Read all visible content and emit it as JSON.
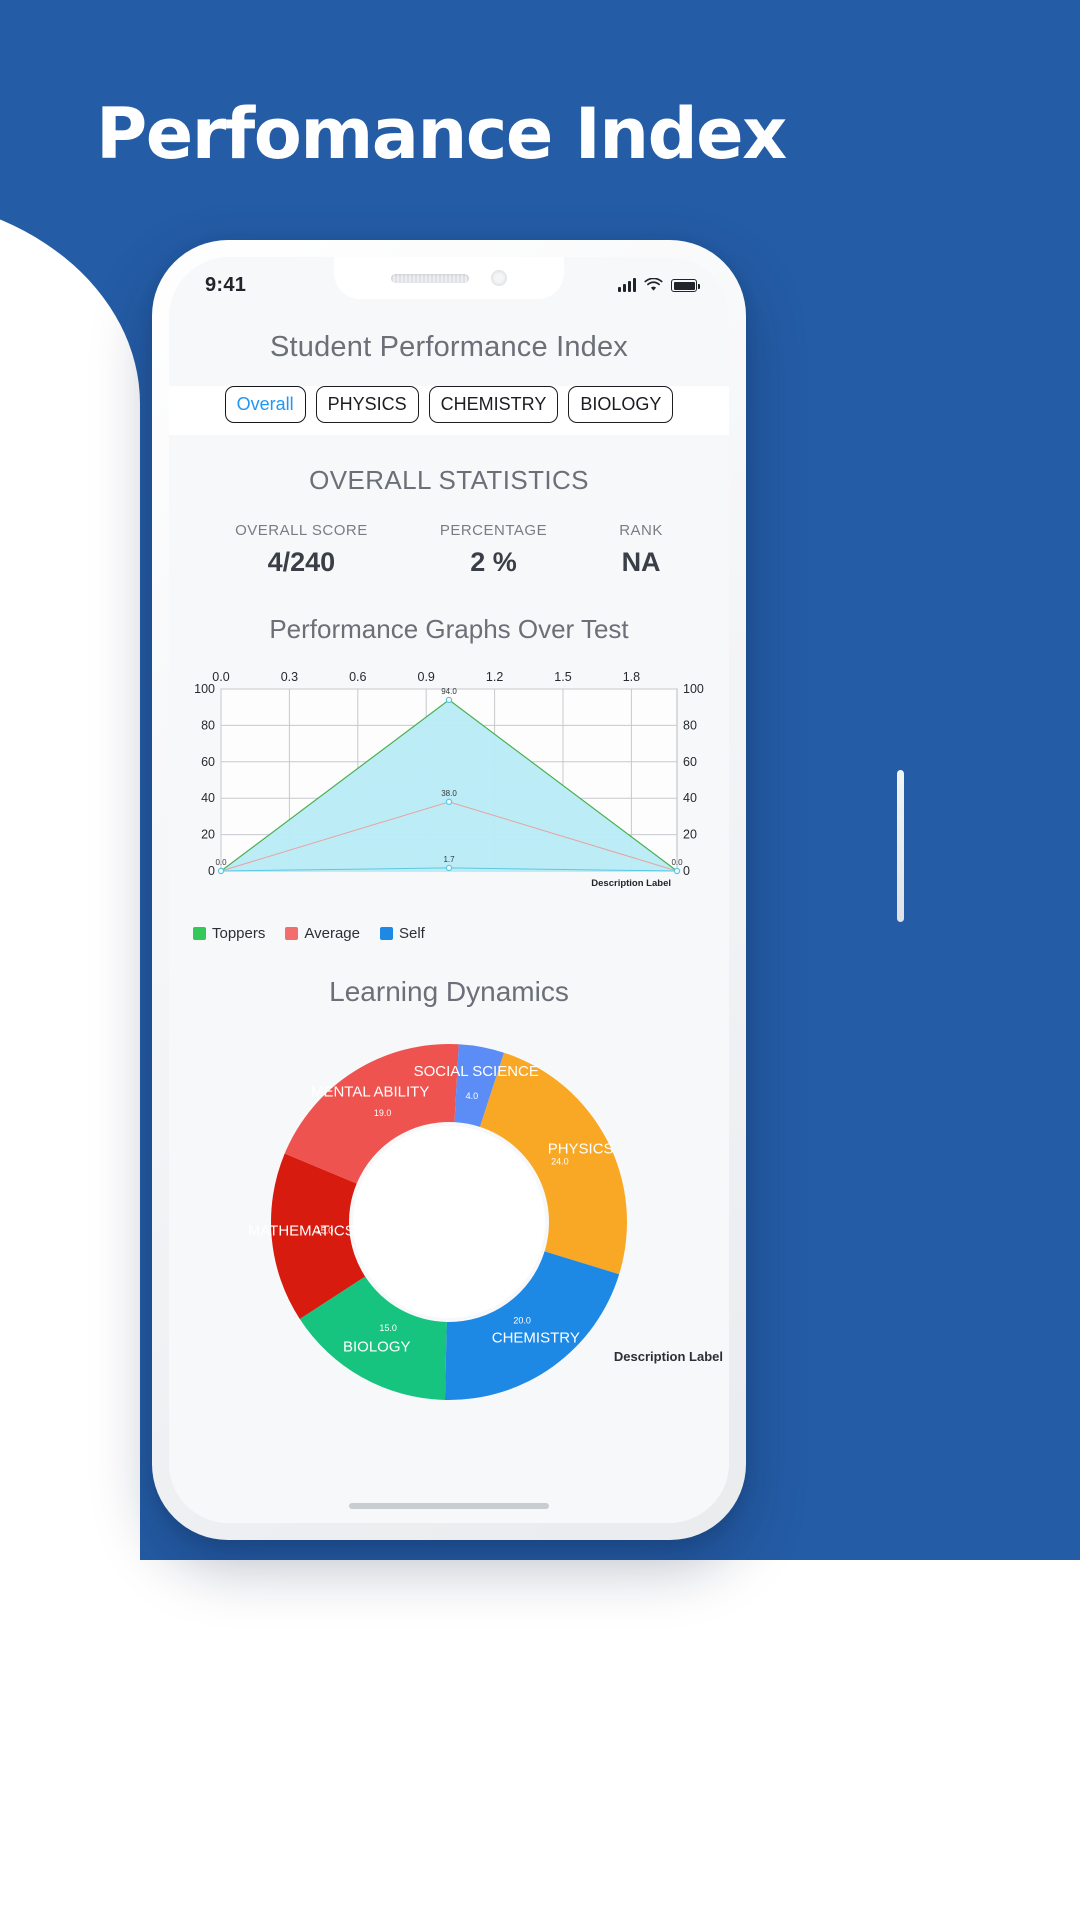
{
  "poster": {
    "headline": "Perfomance Index",
    "brand_blue": "#245ca5"
  },
  "phone": {
    "status_bar": {
      "clock": "9:41",
      "signal_icon": "cellular-bars-icon",
      "wifi_icon": "wifi-icon",
      "battery_icon": "battery-full-icon"
    },
    "home_indicator": "home-indicator"
  },
  "app": {
    "title": "Student Performance Index",
    "tabs": [
      {
        "label": "Overall",
        "active": true
      },
      {
        "label": "PHYSICS",
        "active": false
      },
      {
        "label": "CHEMISTRY",
        "active": false
      },
      {
        "label": "BIOLOGY",
        "active": false
      }
    ],
    "section_title": "OVERALL STATISTICS",
    "stats": [
      {
        "label": "OVERALL SCORE",
        "value": "4/240"
      },
      {
        "label": "PERCENTAGE",
        "value": "2 %"
      },
      {
        "label": "RANK",
        "value": "NA"
      }
    ],
    "graph_title": "Performance Graphs Over Test",
    "legend": [
      {
        "label": "Toppers",
        "color": "#34c759"
      },
      {
        "label": "Average",
        "color": "#f26d6d"
      },
      {
        "label": "Self",
        "color": "#1e88e5"
      }
    ],
    "chart_description_label": "Description Label",
    "dynamics_title": "Learning Dynamics",
    "donut_description_label": "Description Label"
  },
  "chart_data": [
    {
      "type": "line",
      "title": "Performance Graphs Over Test",
      "xlabel": "",
      "ylabel": "",
      "xlim": [
        0.0,
        2.0
      ],
      "ylim": [
        0,
        100
      ],
      "xticks": [
        "0.0",
        "0.3",
        "0.6",
        "0.9",
        "1.2",
        "1.5",
        "1.8"
      ],
      "xtick_values": [
        0.0,
        0.3,
        0.6,
        0.9,
        1.2,
        1.5,
        1.8
      ],
      "yticks_left": [
        "0",
        "20",
        "40",
        "60",
        "80",
        "100"
      ],
      "yticks_right": [
        "0",
        "20",
        "40",
        "60",
        "80",
        "100"
      ],
      "grid": true,
      "legend_position": "bottom-left",
      "annotations": [
        "94.0",
        "38.0",
        "1.7",
        "0.0",
        "0.0"
      ],
      "x": [
        0.0,
        1.0,
        2.0
      ],
      "series": [
        {
          "name": "Toppers",
          "color": "#34c759",
          "values": [
            0.0,
            94.0,
            0.0
          ],
          "labels": [
            "0.0",
            "94.0",
            "0.0"
          ]
        },
        {
          "name": "Average",
          "color": "#f26d6d",
          "values": [
            0.0,
            38.0,
            0.0
          ],
          "labels": [
            "",
            "38.0",
            ""
          ]
        },
        {
          "name": "Self",
          "color": "#1e88e5",
          "values": [
            0.0,
            1.7,
            0.0
          ],
          "labels": [
            "",
            "1.7",
            ""
          ]
        }
      ]
    },
    {
      "type": "pie",
      "title": "Learning Dynamics",
      "donut": true,
      "labels": [
        "PHYSICS",
        "CHEMISTRY",
        "BIOLOGY",
        "MATHEMATICS",
        "MENTAL ABILITY",
        "SOCIAL SCIENCE"
      ],
      "values": [
        24,
        20,
        15,
        15,
        19,
        4
      ],
      "value_labels": [
        "24.0",
        "20.0",
        "15.0",
        "15.0",
        "19.0",
        "4.0"
      ],
      "colors": [
        "#f9a825",
        "#1e88e5",
        "#16c47f",
        "#d81b0f",
        "#ef5350",
        "#5c8df6"
      ]
    }
  ]
}
